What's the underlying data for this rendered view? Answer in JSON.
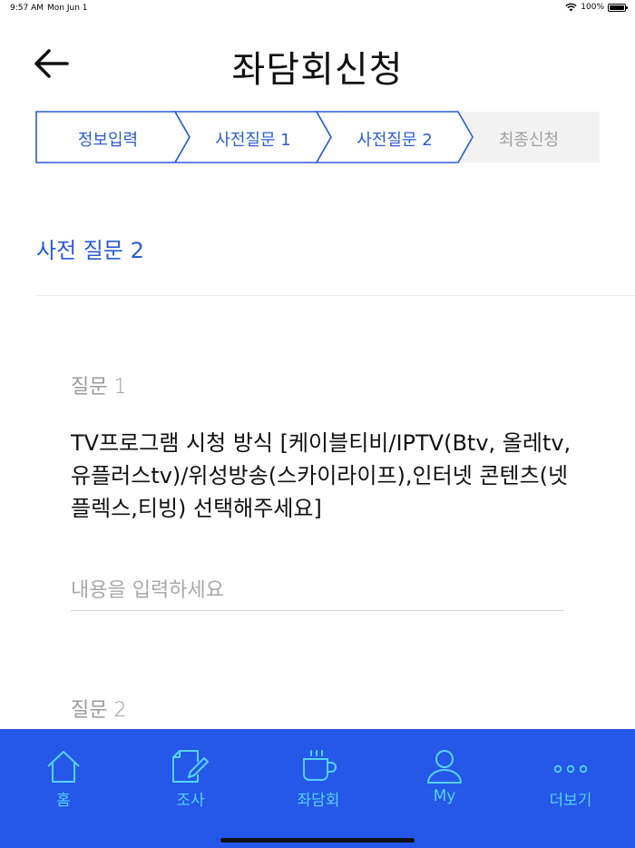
{
  "status_bar": {
    "time": "9:57 AM",
    "date": "Mon Jun 1",
    "battery": "100%"
  },
  "header": {
    "title": "좌담회신청",
    "back_icon": "arrow-left-icon"
  },
  "stepper": {
    "steps": [
      {
        "label": "정보입력",
        "state": "done"
      },
      {
        "label": "사전질문 1",
        "state": "done"
      },
      {
        "label": "사전질문 2",
        "state": "current"
      },
      {
        "label": "최종신청",
        "state": "pending"
      }
    ],
    "active_color": "#2a5bd7",
    "inactive_bg": "#f2f2f2"
  },
  "section": {
    "title": "사전 질문 2"
  },
  "questions": [
    {
      "label": "질문 1",
      "text": "TV프로그램 시청 방식 [케이블티비/IPTV(Btv, 올레tv, 유플러스tv)/위성방송(스카이라이프),인터넷 콘텐츠(넷플렉스,티빙) 선택해주세요]",
      "answer_value": "",
      "answer_placeholder": "내용을 입력하세요"
    },
    {
      "label": "질문 2"
    }
  ],
  "tab_bar": {
    "background": "#2557e8",
    "label_color": "#55d3ff",
    "tabs": [
      {
        "label": "홈",
        "icon": "home-icon"
      },
      {
        "label": "조사",
        "icon": "survey-edit-icon"
      },
      {
        "label": "좌담회",
        "icon": "coffee-cup-icon"
      },
      {
        "label": "My",
        "icon": "user-icon"
      },
      {
        "label": "더보기",
        "icon": "more-dots-icon"
      }
    ]
  }
}
